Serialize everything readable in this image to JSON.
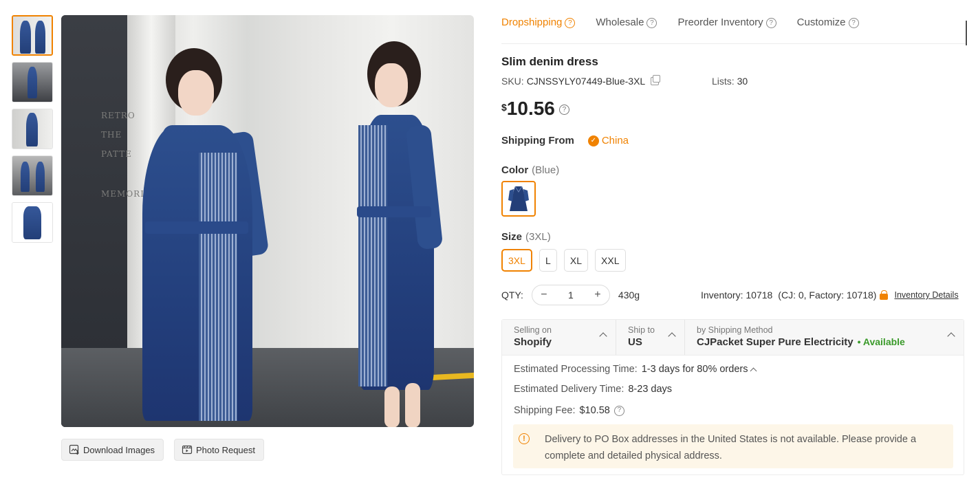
{
  "thumbnails": [
    {
      "name": "thumb-1",
      "active": true
    },
    {
      "name": "thumb-2",
      "active": false
    },
    {
      "name": "thumb-3",
      "active": false
    },
    {
      "name": "thumb-4",
      "active": false
    },
    {
      "name": "thumb-5",
      "active": false
    }
  ],
  "main_image": {
    "wall_text": [
      "RETRO",
      "THE",
      "PATTE",
      "MEMORLES"
    ]
  },
  "image_actions": {
    "download_label": "Download Images",
    "photo_request_label": "Photo Request"
  },
  "tabs": [
    {
      "label": "Dropshipping",
      "active": true
    },
    {
      "label": "Wholesale",
      "active": false
    },
    {
      "label": "Preorder Inventory",
      "active": false
    },
    {
      "label": "Customize",
      "active": false
    }
  ],
  "product": {
    "title": "Slim denim dress",
    "sku_label": "SKU:",
    "sku_value": "CJNSSYLY07449-Blue-3XL",
    "lists_label": "Lists:",
    "lists_value": "30",
    "currency_symbol": "$",
    "price": "10.56"
  },
  "shipping_from": {
    "label": "Shipping From",
    "value": "China"
  },
  "color": {
    "label": "Color",
    "selected": "(Blue)"
  },
  "size": {
    "label": "Size",
    "selected": "(3XL)",
    "options": [
      "3XL",
      "L",
      "XL",
      "XXL"
    ]
  },
  "quantity": {
    "label": "QTY:",
    "value": "1",
    "minus": "−",
    "plus": "+",
    "weight": "430g"
  },
  "inventory": {
    "text": "Inventory: 10718",
    "breakdown": "(CJ: 0, Factory: 10718)",
    "details_link": "Inventory Details"
  },
  "shipping": {
    "selling_on_label": "Selling on",
    "selling_on_value": "Shopify",
    "ship_to_label": "Ship to",
    "ship_to_value": "US",
    "method_label": "by Shipping Method",
    "method_value": "CJPacket Super Pure Electricity",
    "availability": "• Available",
    "processing_label": "Estimated Processing Time:",
    "processing_value": "1-3 days for 80% orders",
    "delivery_label": "Estimated Delivery Time:",
    "delivery_value": "8-23 days",
    "fee_label": "Shipping Fee:",
    "fee_value": "$10.58",
    "notice": "Delivery to PO Box addresses in the United States is not available. Please provide a complete and detailed physical address."
  },
  "colors": {
    "accent": "#f08200",
    "available": "#3a9a2a",
    "denim": "#2d4f8e"
  }
}
